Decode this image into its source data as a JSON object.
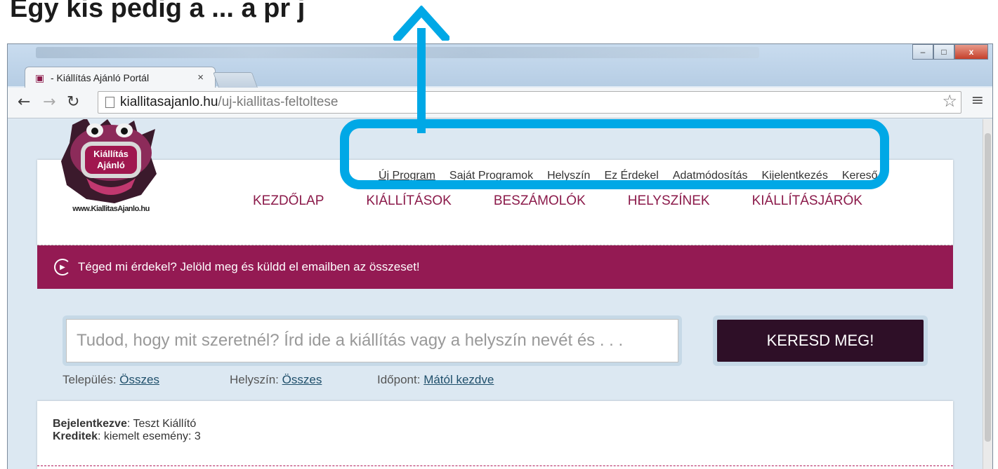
{
  "caption": "Egy kis     pedig a         ... a    pr  j",
  "browser": {
    "tab_title": "- Kiállítás Ajánló Portál",
    "tab_close": "×",
    "url_host": "kiallitasajanlo.hu",
    "url_path": "/uj-kiallitas-feltoltese",
    "window_buttons": {
      "minimize": "–",
      "maximize": "□",
      "close": "x"
    }
  },
  "site": {
    "top_links": [
      {
        "label": "Új Program",
        "active": true
      },
      {
        "label": "Saját Programok",
        "active": false
      },
      {
        "label": "Helyszín",
        "active": false
      },
      {
        "label": "Ez Érdekel",
        "active": false
      },
      {
        "label": "Adatmódosítás",
        "active": false
      },
      {
        "label": "Kijelentkezés",
        "active": false
      },
      {
        "label": "Kereső",
        "active": false
      }
    ],
    "main_nav": [
      "KEZDŐLAP",
      "KIÁLLÍTÁSOK",
      "BESZÁMOLÓK",
      "HELYSZÍNEK",
      "KIÁLLÍTÁSJÁRÓK"
    ],
    "logo": {
      "line1": "Kiállítás",
      "line2": "Ajánló",
      "url": "www.KiallitasAjanlo.hu"
    },
    "banner_text": "Téged mi érdekel? Jelöld meg és küldd el emailben az összeset!",
    "search": {
      "placeholder": "Tudod, hogy mit szeretnél? Írd ide a kiállítás vagy a helyszín nevét és . . .",
      "button_label": "KERESD MEG!"
    },
    "filters": [
      {
        "label": "Település:",
        "value": "Összes"
      },
      {
        "label": "Helyszín:",
        "value": "Összes"
      },
      {
        "label": "Időpont:",
        "value": "Mától kezdve"
      }
    ],
    "user": {
      "logged_in_label": "Bejelentkezve",
      "logged_in_value": ": Teszt Kiállító",
      "credits_label": "Kreditek",
      "credits_value": ": kiemelt esemény: 3"
    }
  },
  "colors": {
    "accent": "#941a53",
    "annotation": "#00a8e6",
    "button_dark": "#2e0f27"
  }
}
